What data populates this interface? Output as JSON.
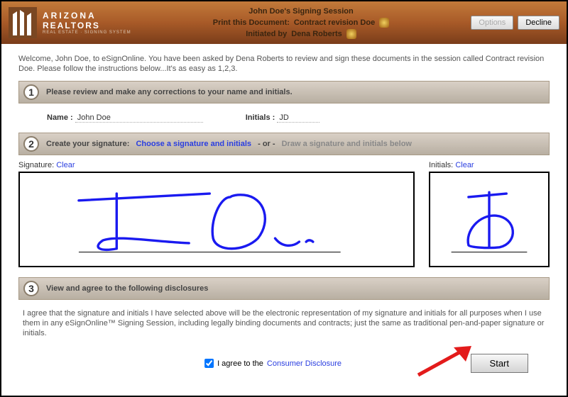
{
  "branding": {
    "line1": "ARIZONA",
    "line2": "REALTORS",
    "tagline": "REAL ESTATE · SIGNING SYSTEM"
  },
  "header": {
    "session_label": "John Doe's Signing Session",
    "print_prefix": "Print this Document:",
    "print_doc": "Contract revision Doe",
    "initiated_prefix": "Initiated by",
    "initiated_by": "Dena Roberts",
    "buttons": {
      "options": "Options",
      "decline": "Decline"
    }
  },
  "welcome": "Welcome, John Doe, to eSignOnline. You have been asked by Dena Roberts to review and sign these documents in the session called Contract revision Doe. Please follow the instructions below...It's as easy as 1,2,3.",
  "step1": {
    "num": "1",
    "label": "Please review and make any corrections to your name and initials.",
    "name_label": "Name :",
    "name_value": "John Doe",
    "initials_label": "Initials :",
    "initials_value": "JD"
  },
  "step2": {
    "num": "2",
    "label": "Create your signature:",
    "choose": "Choose a signature and initials",
    "or": "- or -",
    "draw": "Draw a signature and initials below",
    "signature_label": "Signature:",
    "initials_label": "Initials:",
    "clear": "Clear"
  },
  "step3": {
    "num": "3",
    "label": "View and agree to the following disclosures",
    "text": "I agree that the signature and initials I have selected above will be the electronic representation of my signature and initials for all purposes when I use them in any eSignOnline™ Signing Session, including legally binding documents and contracts; just the same as traditional pen-and-paper signature or initials."
  },
  "footer": {
    "agree_prefix": "I agree to the",
    "disclosure_link": "Consumer Disclosure",
    "start": "Start"
  }
}
